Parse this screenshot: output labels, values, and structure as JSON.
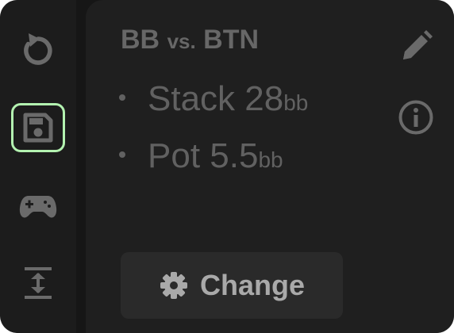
{
  "sidebar": {
    "items": [
      {
        "name": "reset",
        "icon": "rotate-ccw-icon",
        "active": false
      },
      {
        "name": "save",
        "icon": "floppy-disk-icon",
        "active": true
      },
      {
        "name": "game",
        "icon": "gamepad-icon",
        "active": false
      },
      {
        "name": "spacing",
        "icon": "vertical-expand-icon",
        "active": false
      }
    ]
  },
  "panel": {
    "title_positions": "BB",
    "title_vs": "vs.",
    "title_opponent": "BTN",
    "stack_label": "Stack",
    "stack_value": "28",
    "stack_unit": "bb",
    "pot_label": "Pot",
    "pot_value": "5.5",
    "pot_unit": "bb",
    "edit_icon": "pencil-icon",
    "info_icon": "info-circle-icon",
    "change_label": "Change",
    "change_icon": "gear-icon"
  },
  "colors": {
    "background": "#161616",
    "sidebar": "#1c1c1c",
    "panel": "#1f1f1f",
    "active_outline": "#b3f2b0",
    "icon": "#6a6a6a",
    "text": "#616161",
    "button_bg": "#2a2a2a",
    "button_text": "#a9a9a9"
  }
}
